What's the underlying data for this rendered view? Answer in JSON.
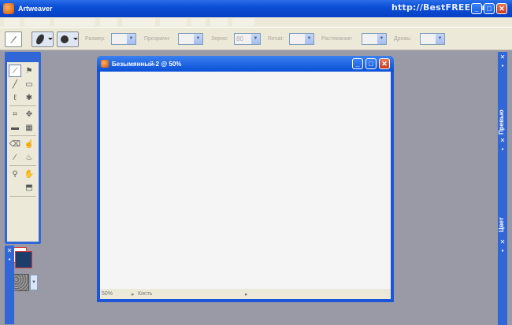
{
  "app": {
    "title": "Artweaver",
    "watermark": "http://BestFREE.ru"
  },
  "window_buttons": {
    "minimize": "_",
    "maximize": "□",
    "close": "✕"
  },
  "options": {
    "size_label": "Размер:",
    "opacity_label": "Прозрачн:",
    "grain_label": "Зерно:",
    "grain_value": "80",
    "blend_label": "Resat:",
    "spread_label": "Растекание:",
    "jitter_label": "Дрожь:"
  },
  "document": {
    "title": "Безымянный-2 @ 50%",
    "zoom": "50%",
    "tool": "Кисть"
  },
  "side_panels": {
    "preview": "Превью",
    "color": "Цвет"
  },
  "colors": {
    "accent": "#3166d6",
    "foreground": "#1d3e6a",
    "background": "#ffffff",
    "toolbar": "#ece9d8"
  }
}
